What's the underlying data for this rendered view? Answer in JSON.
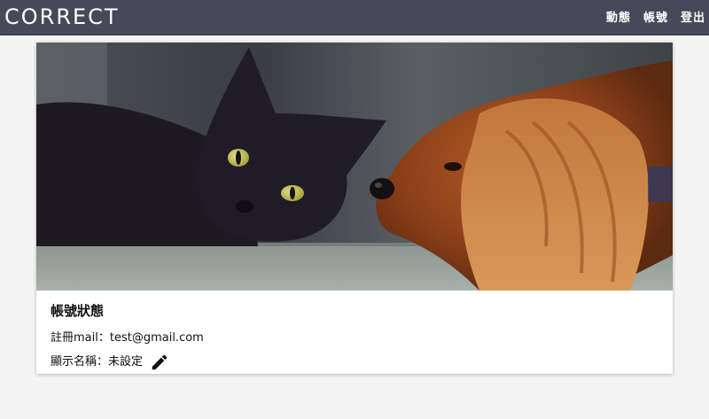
{
  "navbar": {
    "brand": "CORRECT",
    "links": [
      {
        "label": "動態"
      },
      {
        "label": "帳號"
      },
      {
        "label": "登出"
      }
    ]
  },
  "card": {
    "title": "帳號狀態",
    "email_label": "註冊mail：",
    "email_value": "test@gmail.com",
    "display_name_label": "顯示名稱：",
    "display_name_value": "未設定",
    "edit_icon": "pencil-icon"
  },
  "colors": {
    "navbar_bg": "#444a5a",
    "page_bg": "#f4f4f4",
    "card_bg": "#ffffff"
  }
}
